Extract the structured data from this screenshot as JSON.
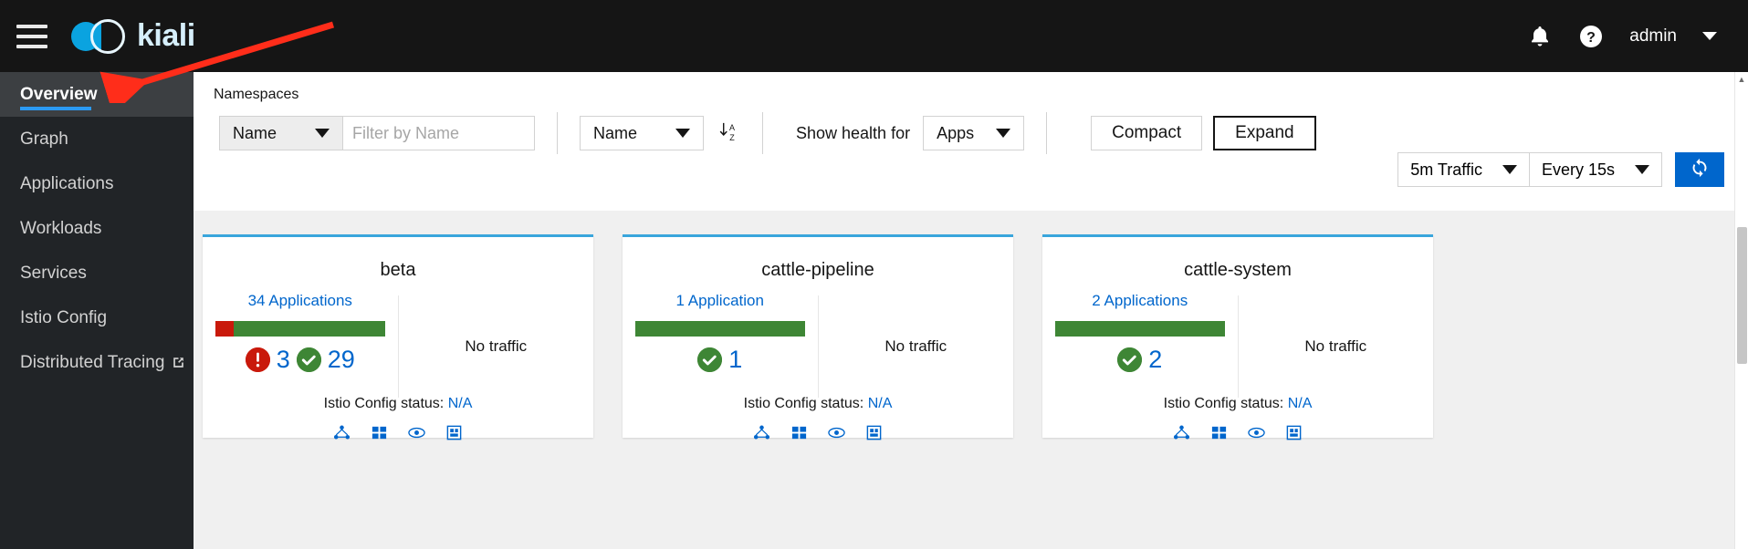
{
  "masthead": {
    "menu_icon": "hamburger-icon",
    "brand": "kiali",
    "notifications_icon": "bell-icon",
    "help_icon": "help-circle-icon",
    "username": "admin",
    "user_caret_icon": "chevron-down-icon"
  },
  "sidebar": {
    "items": [
      {
        "label": "Overview",
        "active": true
      },
      {
        "label": "Graph",
        "active": false
      },
      {
        "label": "Applications",
        "active": false
      },
      {
        "label": "Workloads",
        "active": false
      },
      {
        "label": "Services",
        "active": false
      },
      {
        "label": "Istio Config",
        "active": false
      },
      {
        "label": "Distributed Tracing",
        "active": false,
        "external_icon": "external-link-icon"
      }
    ]
  },
  "toolbar": {
    "section_label": "Namespaces",
    "filter_type": "Name",
    "filter_placeholder": "Filter by Name",
    "filter_value": "",
    "sort_by": "Name",
    "sort_direction_icon": "sort-alpha-down-icon",
    "show_health_label": "Show health for",
    "health_for": "Apps",
    "compact_label": "Compact",
    "expand_label": "Expand",
    "expand_active": true,
    "traffic_range": "5m Traffic",
    "refresh_interval": "Every 15s",
    "refresh_icon": "sync-icon",
    "accent_color": "#0066cc"
  },
  "cards": [
    {
      "name": "beta",
      "apps_link": "34 Applications",
      "health_red_pct": 11,
      "health_green_pct": 89,
      "error_count": "3",
      "healthy_count": "29",
      "traffic": "No traffic",
      "istio_label": "Istio Config status:",
      "istio_value": "N/A",
      "icons": [
        "graph-icon",
        "applications-icon",
        "services-icon",
        "workloads-icon"
      ]
    },
    {
      "name": "cattle-pipeline",
      "apps_link": "1 Application",
      "health_red_pct": 0,
      "health_green_pct": 100,
      "error_count": "",
      "healthy_count": "1",
      "traffic": "No traffic",
      "istio_label": "Istio Config status:",
      "istio_value": "N/A",
      "icons": [
        "graph-icon",
        "applications-icon",
        "services-icon",
        "workloads-icon"
      ]
    },
    {
      "name": "cattle-system",
      "apps_link": "2 Applications",
      "health_red_pct": 0,
      "health_green_pct": 100,
      "error_count": "",
      "healthy_count": "2",
      "traffic": "No traffic",
      "istio_label": "Istio Config status:",
      "istio_value": "N/A",
      "icons": [
        "graph-icon",
        "applications-icon",
        "services-icon",
        "workloads-icon"
      ]
    }
  ],
  "annotation": {
    "type": "arrow",
    "color": "#ff2d1a",
    "points_to": "Overview"
  },
  "colors": {
    "error": "#c9190b",
    "success": "#3e8635",
    "link": "#0066cc",
    "card_top": "#39a5dc"
  }
}
